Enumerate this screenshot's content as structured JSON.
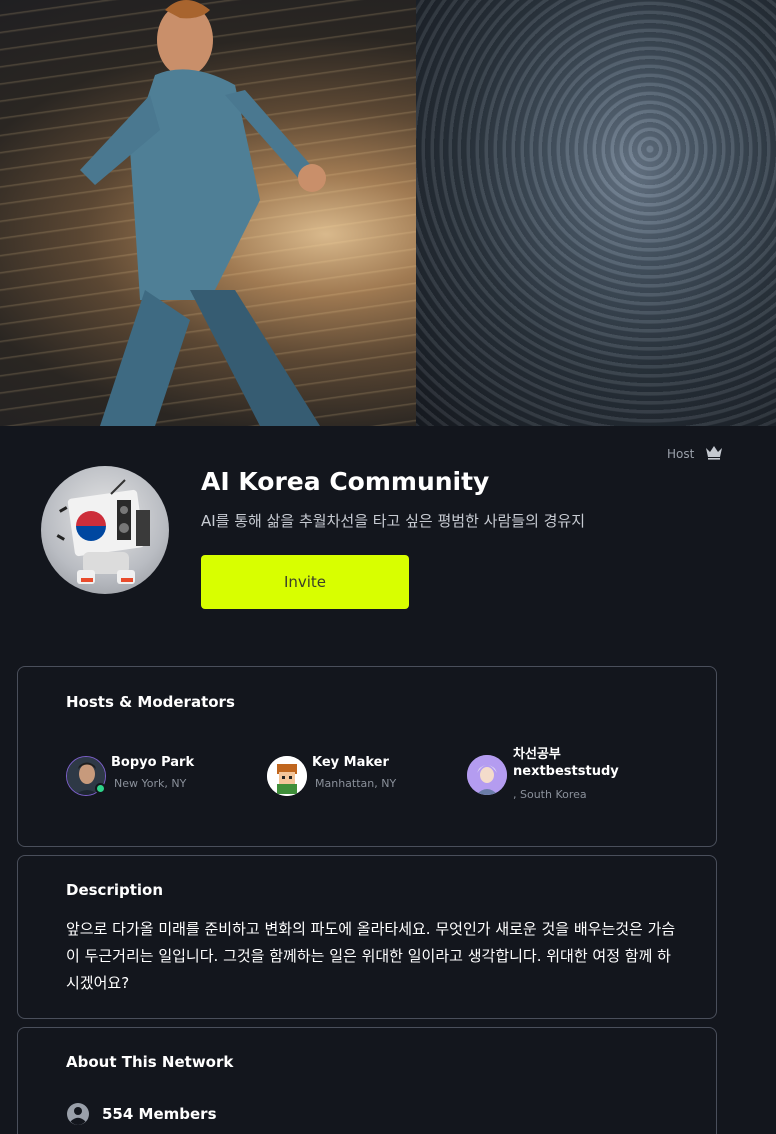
{
  "banner": {
    "image": "runner-and-robot-banner"
  },
  "host_label": "Host",
  "community": {
    "title": "AI Korea Community",
    "subtitle": "AI를 통해 삶을 추월차선을 타고 싶은 평범한 사람들의 경유지",
    "invite_label": "Invite",
    "accent": "#d8ff00"
  },
  "hosts": {
    "heading": "Hosts & Moderators",
    "people": [
      {
        "name": "Bopyo Park",
        "location": "New York, NY",
        "online": true
      },
      {
        "name": "Key Maker",
        "location": "Manhattan, NY",
        "online": false
      },
      {
        "name_line1": "차선공부",
        "name_line2": "nextbeststudy",
        "location": ", South Korea",
        "online": false
      }
    ]
  },
  "description": {
    "heading": "Description",
    "text": "앞으로 다가올 미래를 준비하고 변화의 파도에 올라타세요. 무엇인가 새로운 것을 배우는것은 가슴이 두근거리는 일입니다. 그것을 함께하는 일은 위대한 일이라고 생각합니다. 위대한 여정 함께 하시겠어요?"
  },
  "about": {
    "heading": "About This Network",
    "members": "554 Members"
  },
  "icons": {
    "host": "crown-icon",
    "members": "user-circle-icon"
  }
}
